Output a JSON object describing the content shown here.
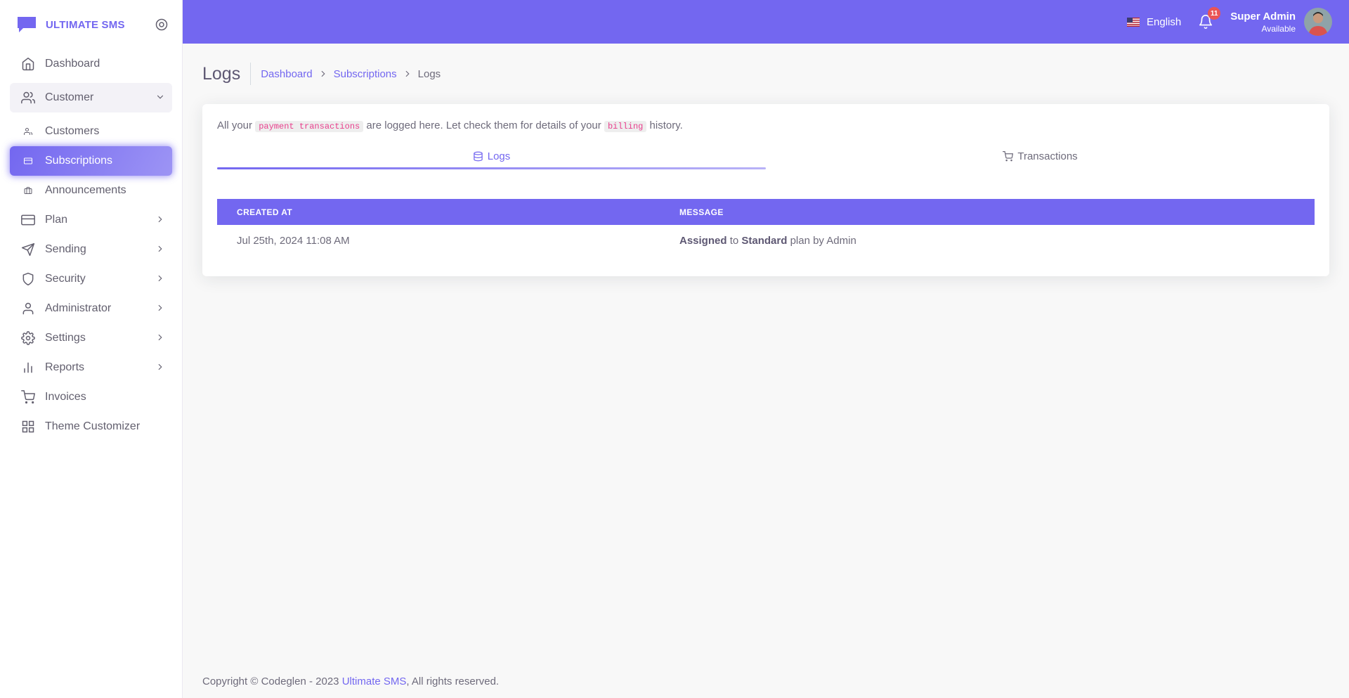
{
  "brand": {
    "name": "ULTIMATE SMS",
    "accent": "#7367f0"
  },
  "sidebar": {
    "items": [
      {
        "label": "Dashboard",
        "icon": "home-icon"
      },
      {
        "label": "Customer",
        "icon": "users-icon"
      },
      {
        "label": "Customers",
        "icon": "users-small-icon"
      },
      {
        "label": "Subscriptions",
        "icon": "credit-card-small-icon"
      },
      {
        "label": "Announcements",
        "icon": "briefcase-small-icon"
      },
      {
        "label": "Plan",
        "icon": "credit-card-icon"
      },
      {
        "label": "Sending",
        "icon": "send-icon"
      },
      {
        "label": "Security",
        "icon": "shield-icon"
      },
      {
        "label": "Administrator",
        "icon": "user-icon"
      },
      {
        "label": "Settings",
        "icon": "settings-icon"
      },
      {
        "label": "Reports",
        "icon": "bar-chart-icon"
      },
      {
        "label": "Invoices",
        "icon": "shopping-cart-icon"
      },
      {
        "label": "Theme Customizer",
        "icon": "grid-icon"
      }
    ]
  },
  "navbar": {
    "language": "English",
    "notification_count": "11",
    "user_name": "Super Admin",
    "user_status": "Available"
  },
  "page": {
    "title": "Logs",
    "breadcrumb": [
      "Dashboard",
      "Subscriptions",
      "Logs"
    ]
  },
  "card": {
    "intro_1": "All your",
    "code_1": "payment transactions",
    "intro_2": "are logged here. Let check them for details of your",
    "code_2": "billing",
    "intro_3": "history.",
    "tabs": [
      {
        "label": "Logs",
        "icon": "database-icon"
      },
      {
        "label": "Transactions",
        "icon": "shopping-cart-icon"
      }
    ],
    "table": {
      "columns": [
        "Created At",
        "Message"
      ],
      "rows": [
        {
          "created_at": "Jul 25th, 2024 11:08 AM",
          "msg_b1": "Assigned",
          "msg_t1": "to",
          "msg_b2": "Standard",
          "msg_t2": "plan by Admin"
        }
      ]
    }
  },
  "footer": {
    "text": "Copyright © Codeglen - 2023",
    "link": "Ultimate SMS",
    "suffix": ", All rights reserved."
  }
}
